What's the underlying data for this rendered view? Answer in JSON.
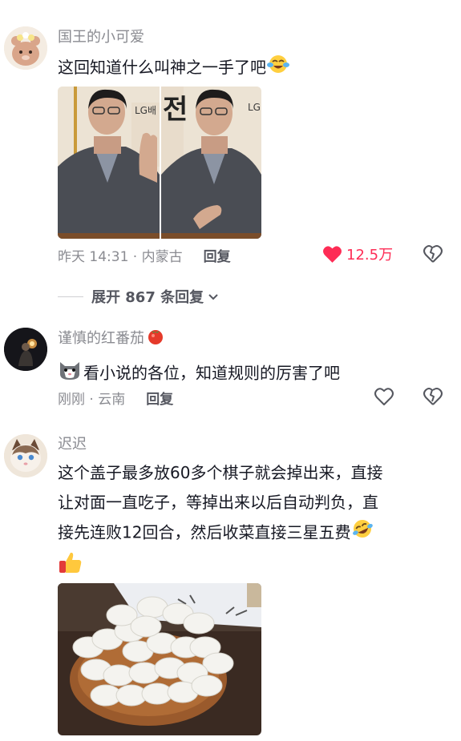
{
  "comments": [
    {
      "username": "国王的小可爱",
      "text": "这回知道什么叫神之一手了吧",
      "time_location": "昨天 14:31 · 内蒙古",
      "reply_label": "回复",
      "like_count": "12.5万",
      "liked": true,
      "photo_sign_left": "LG배",
      "photo_sign_right": "전",
      "photo_sign_right2": "LG"
    },
    {
      "username": "谨慎的红番茄",
      "text": "看小说的各位，知道规则的厉害了吧",
      "time_location": "刚刚 · 云南",
      "reply_label": "回复"
    },
    {
      "username": "迟迟",
      "text_line1": "这个盖子最多放60多个棋子就会掉出来，直接",
      "text_line2": "让对面一直吃子，等掉出来以后自动判负，直",
      "text_line3": "接先连败12回合，然后收菜直接三星五费"
    }
  ],
  "expand_replies": "展开 867 条回复",
  "colors": {
    "liked_red": "#fe2c55",
    "meta_gray": "#8a8b91",
    "text": "#161823"
  },
  "icons": [
    "heart-filled-icon",
    "heart-outline-icon",
    "heart-broken-icon",
    "chevron-down-icon",
    "crying-laughing-emoji",
    "cat-emoji",
    "rofl-emoji",
    "thumbs-up-emoji",
    "tomato-emoji"
  ]
}
